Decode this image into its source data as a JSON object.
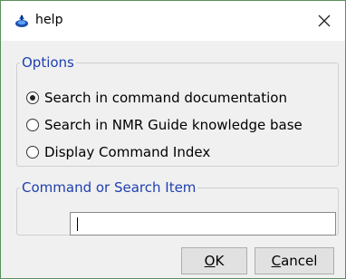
{
  "window": {
    "title": "help",
    "close_glyph": "✕"
  },
  "options": {
    "legend": "Options",
    "items": [
      {
        "label": "Search in command documentation",
        "checked": true
      },
      {
        "label": "Search in NMR Guide knowledge base",
        "checked": false
      },
      {
        "label": "Display Command Index",
        "checked": false
      }
    ]
  },
  "command": {
    "legend": "Command or Search Item",
    "value": ""
  },
  "buttons": {
    "ok": {
      "mnemonic": "O",
      "rest": "K"
    },
    "cancel": {
      "mnemonic": "C",
      "rest": "ancel"
    }
  },
  "colors": {
    "legend_text": "#1e3fb0",
    "window_border": "#5a8f5a"
  },
  "icons": {
    "app": "topspin-app-icon",
    "close": "close-icon"
  }
}
